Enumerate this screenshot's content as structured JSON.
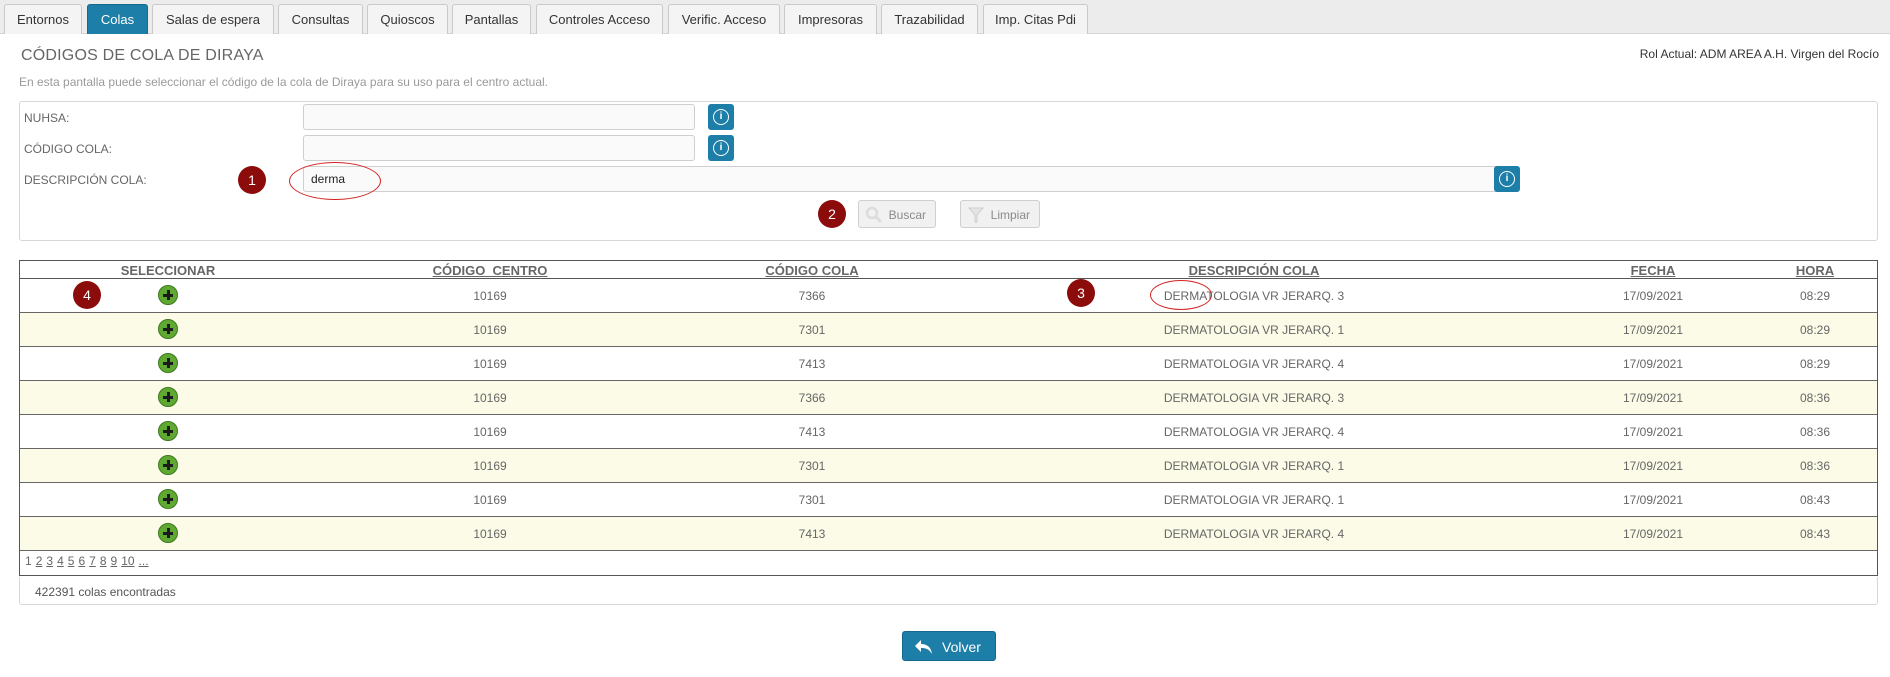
{
  "tabs": [
    {
      "label": "Entornos",
      "active": false
    },
    {
      "label": "Colas",
      "active": true
    },
    {
      "label": "Salas de espera",
      "active": false
    },
    {
      "label": "Consultas",
      "active": false
    },
    {
      "label": "Quioscos",
      "active": false
    },
    {
      "label": "Pantallas",
      "active": false
    },
    {
      "label": "Controles Acceso",
      "active": false
    },
    {
      "label": "Verific. Acceso",
      "active": false
    },
    {
      "label": "Impresoras",
      "active": false
    },
    {
      "label": "Trazabilidad",
      "active": false
    },
    {
      "label": "Imp. Citas Pdi",
      "active": false
    }
  ],
  "header": {
    "title": "CÓDIGOS DE COLA DE DIRAYA",
    "role": "Rol Actual: ADM AREA A.H. Virgen del Rocío",
    "subtitle": "En esta pantalla puede seleccionar el código de la cola de Diraya para su uso para el centro actual."
  },
  "form": {
    "nuhsa_label": "NUHSA:",
    "nuhsa_value": "",
    "codigo_label": "CÓDIGO COLA:",
    "codigo_value": "",
    "descripcion_label": "DESCRIPCIÓN COLA:",
    "descripcion_value": "derma",
    "info_icon": "i",
    "search_label": "Buscar",
    "clear_label": "Limpiar"
  },
  "markers": [
    "1",
    "2",
    "3",
    "4"
  ],
  "table": {
    "columns": [
      "SELECCIONAR",
      "CÓDIGO_CENTRO",
      "CÓDIGO COLA",
      "DESCRIPCIÓN COLA",
      "FECHA",
      "HORA"
    ],
    "rows": [
      {
        "centro": "10169",
        "cola": "7366",
        "descripcion": "DERMATOLOGIA VR JERARQ. 3",
        "fecha": "17/09/2021",
        "hora": "08:29"
      },
      {
        "centro": "10169",
        "cola": "7301",
        "descripcion": "DERMATOLOGIA VR JERARQ. 1",
        "fecha": "17/09/2021",
        "hora": "08:29"
      },
      {
        "centro": "10169",
        "cola": "7413",
        "descripcion": "DERMATOLOGIA VR JERARQ. 4",
        "fecha": "17/09/2021",
        "hora": "08:29"
      },
      {
        "centro": "10169",
        "cola": "7366",
        "descripcion": "DERMATOLOGIA VR JERARQ. 3",
        "fecha": "17/09/2021",
        "hora": "08:36"
      },
      {
        "centro": "10169",
        "cola": "7413",
        "descripcion": "DERMATOLOGIA VR JERARQ. 4",
        "fecha": "17/09/2021",
        "hora": "08:36"
      },
      {
        "centro": "10169",
        "cola": "7301",
        "descripcion": "DERMATOLOGIA VR JERARQ. 1",
        "fecha": "17/09/2021",
        "hora": "08:36"
      },
      {
        "centro": "10169",
        "cola": "7301",
        "descripcion": "DERMATOLOGIA VR JERARQ. 1",
        "fecha": "17/09/2021",
        "hora": "08:43"
      },
      {
        "centro": "10169",
        "cola": "7413",
        "descripcion": "DERMATOLOGIA VR JERARQ. 4",
        "fecha": "17/09/2021",
        "hora": "08:43"
      }
    ],
    "pages": [
      "1",
      "2",
      "3",
      "4",
      "5",
      "6",
      "7",
      "8",
      "9",
      "10",
      "..."
    ],
    "current_page": "1"
  },
  "result_count": "422391 colas encontradas",
  "back_label": "Volver",
  "colors": {
    "accent": "#1d7ea8",
    "marker": "#8c0b0b",
    "row_alt": "#fbfbe7",
    "add_icon": "#5fa832"
  }
}
